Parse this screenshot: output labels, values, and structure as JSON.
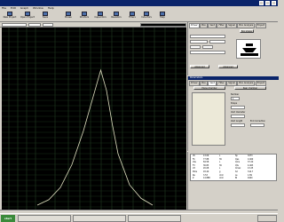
{
  "window": {
    "title": ""
  },
  "menu": {
    "items": [
      "File",
      "Edit",
      "Graph",
      "Window",
      "Help"
    ]
  },
  "toolbar": {
    "buttons": [
      "New Project",
      "Open Project",
      "Save",
      "Boxes",
      "Woofers",
      "Capacitors",
      "Resistors",
      "Filters",
      "Inductors",
      "Help"
    ]
  },
  "graph_toolbar": {
    "selection": "",
    "scale": "",
    "option": ""
  },
  "right_top": {
    "tabs": [
      "Driver",
      "Box",
      "Vent",
      "Filter",
      "Signal",
      "Box Analysis",
      "Project"
    ],
    "buttons": [
      "Box shape",
      "Advanced"
    ]
  },
  "right_mid": {
    "header": "Parameters",
    "tabs": [
      "Driver",
      "Box",
      "Vent",
      "Filter",
      "Signal",
      "Box Analysis",
      "Project"
    ],
    "subtabs": [
      "Plane chamber",
      "Rear chamber"
    ],
    "labels": [
      "Number",
      "Shape",
      "Vent diameter",
      "Vent length",
      "End Correction"
    ],
    "values": [
      "1",
      "",
      "",
      "",
      ""
    ]
  },
  "right_bot": {
    "rows": [
      [
        "Vb",
        "13.06",
        "L",
        "Sp",
        "3273"
      ],
      [
        "Fb",
        "77.88",
        "Hz",
        "Qes",
        "0.469"
      ],
      [
        "Vas",
        "84.58",
        "L",
        "Qms",
        "37.20"
      ],
      [
        "F3",
        "36.83",
        "Hz",
        "Qts",
        "4.463"
      ],
      [
        "Vd",
        "20.08",
        "L",
        "Xmax",
        "13.25"
      ],
      [
        "Mms",
        "93.40",
        "g",
        "Sd",
        "314.7"
      ],
      [
        "Re",
        "3.53",
        "ohm",
        "Le",
        "1.89"
      ],
      [
        "Z",
        "14.888",
        "ohm",
        "Bl",
        "9440"
      ]
    ]
  },
  "statusbar": {
    "text": ""
  },
  "taskbar": {
    "start": "start",
    "tasks": [
      "",
      "",
      ""
    ],
    "clock": ""
  },
  "chart_data": {
    "type": "line",
    "series": [
      {
        "x": [
          0,
          10,
          20,
          30,
          40,
          50,
          55,
          60,
          65,
          70,
          80,
          90,
          100
        ],
        "values": [
          0,
          4,
          13,
          30,
          55,
          85,
          100,
          85,
          60,
          38,
          15,
          5,
          0
        ]
      }
    ],
    "grid": true,
    "ylim": [
      0,
      100
    ]
  }
}
